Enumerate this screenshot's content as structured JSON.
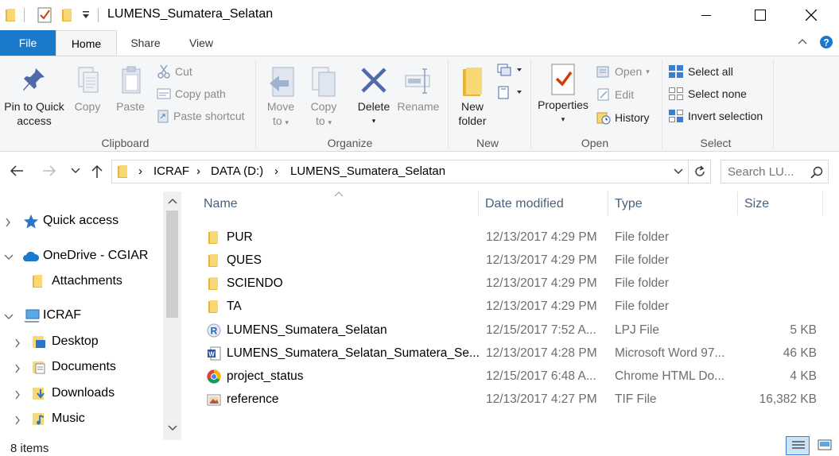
{
  "window": {
    "title": "LUMENS_Sumatera_Selatan",
    "minimize_label": "—",
    "maximize_label": "☐",
    "close_label": "✕"
  },
  "ribbon_tabs": [
    "File",
    "Home",
    "Share",
    "View"
  ],
  "ribbon": {
    "clipboard": {
      "label": "Clipboard",
      "pin_label_1": "Pin to Quick",
      "pin_label_2": "access",
      "copy": "Copy",
      "paste": "Paste",
      "cut": "Cut",
      "copy_path": "Copy path",
      "paste_shortcut": "Paste shortcut"
    },
    "organize": {
      "label": "Organize",
      "move_to_1": "Move",
      "move_to_2": "to",
      "copy_to_1": "Copy",
      "copy_to_2": "to",
      "delete": "Delete",
      "rename": "Rename"
    },
    "new": {
      "label": "New",
      "new_folder_1": "New",
      "new_folder_2": "folder"
    },
    "open": {
      "label": "Open",
      "properties": "Properties",
      "open": "Open",
      "edit": "Edit",
      "history": "History"
    },
    "select": {
      "label": "Select",
      "select_all": "Select all",
      "select_none": "Select none",
      "invert_selection": "Invert selection"
    }
  },
  "address": {
    "crumbs": [
      "ICRAF",
      "DATA (D:)",
      "LUMENS_Sumatera_Selatan"
    ],
    "search_placeholder": "Search LU..."
  },
  "nav": {
    "items": [
      {
        "label": "Quick access",
        "icon": "star-icon"
      },
      {
        "label": "OneDrive - CGIAR",
        "icon": "cloud-icon"
      },
      {
        "label": "Attachments",
        "icon": "folder-icon"
      },
      {
        "label": "ICRAF",
        "icon": "computer-icon"
      },
      {
        "label": "Desktop",
        "icon": "desktop-folder-icon"
      },
      {
        "label": "Documents",
        "icon": "documents-folder-icon"
      },
      {
        "label": "Downloads",
        "icon": "downloads-folder-icon"
      },
      {
        "label": "Music",
        "icon": "music-folder-icon"
      }
    ]
  },
  "columns": {
    "name": "Name",
    "date": "Date modified",
    "type": "Type",
    "size": "Size"
  },
  "files": [
    {
      "name": "PUR",
      "date": "12/13/2017 4:29 PM",
      "type": "File folder",
      "size": "",
      "icon": "folder-icon"
    },
    {
      "name": "QUES",
      "date": "12/13/2017 4:29 PM",
      "type": "File folder",
      "size": "",
      "icon": "folder-icon"
    },
    {
      "name": "SCIENDO",
      "date": "12/13/2017 4:29 PM",
      "type": "File folder",
      "size": "",
      "icon": "folder-icon"
    },
    {
      "name": "TA",
      "date": "12/13/2017 4:29 PM",
      "type": "File folder",
      "size": "",
      "icon": "folder-icon"
    },
    {
      "name": "LUMENS_Sumatera_Selatan",
      "date": "12/15/2017 7:52 A...",
      "type": "LPJ File",
      "size": "5 KB",
      "icon": "r-project-icon"
    },
    {
      "name": "LUMENS_Sumatera_Selatan_Sumatera_Se...",
      "date": "12/13/2017 4:28 PM",
      "type": "Microsoft Word 97...",
      "size": "46 KB",
      "icon": "word-doc-icon"
    },
    {
      "name": "project_status",
      "date": "12/15/2017 6:48 A...",
      "type": "Chrome HTML Do...",
      "size": "4 KB",
      "icon": "chrome-icon"
    },
    {
      "name": "reference",
      "date": "12/13/2017 4:27 PM",
      "type": "TIF File",
      "size": "16,382 KB",
      "icon": "image-file-icon"
    }
  ],
  "status": {
    "item_count": "8 items"
  }
}
